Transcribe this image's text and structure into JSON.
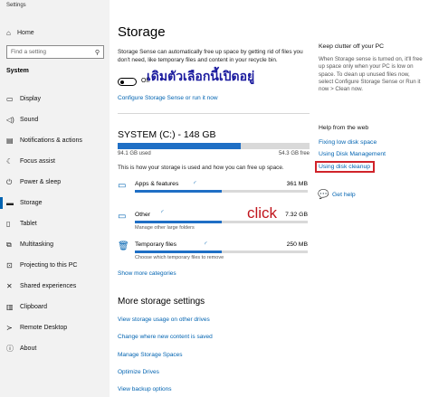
{
  "window": {
    "title": "Settings"
  },
  "sidebar": {
    "home_label": "Home",
    "search_placeholder": "Find a setting",
    "section_label": "System",
    "items": [
      {
        "label": "Display",
        "icon": "display-icon"
      },
      {
        "label": "Sound",
        "icon": "sound-icon"
      },
      {
        "label": "Notifications & actions",
        "icon": "notifications-icon"
      },
      {
        "label": "Focus assist",
        "icon": "focus-assist-icon"
      },
      {
        "label": "Power & sleep",
        "icon": "power-icon"
      },
      {
        "label": "Storage",
        "icon": "storage-icon",
        "active": true
      },
      {
        "label": "Tablet",
        "icon": "tablet-icon"
      },
      {
        "label": "Multitasking",
        "icon": "multitasking-icon"
      },
      {
        "label": "Projecting to this PC",
        "icon": "projecting-icon"
      },
      {
        "label": "Shared experiences",
        "icon": "shared-experiences-icon"
      },
      {
        "label": "Clipboard",
        "icon": "clipboard-icon"
      },
      {
        "label": "Remote Desktop",
        "icon": "remote-desktop-icon"
      },
      {
        "label": "About",
        "icon": "info-icon"
      }
    ]
  },
  "main": {
    "title": "Storage",
    "description": "Storage Sense can automatically free up space by getting rid of files you don't need, like temporary files and content in your recycle bin.",
    "storage_sense": {
      "state_label": "Off",
      "on": false
    },
    "thai_annotation": "เดิมตัวเลือกนี้เปิดอยู่",
    "configure_link": "Configure Storage Sense or run it now",
    "drive": {
      "title": "SYSTEM (C:) - 148 GB",
      "used": "94.1 GB used",
      "free": "54.3 GB free",
      "used_fraction": 0.64,
      "description": "This is how your storage is used and how you can free up space."
    },
    "categories": [
      {
        "name": "Apps & features",
        "size": "361 MB",
        "detail": "",
        "icon": "apps-features-icon",
        "fill": 0.5
      },
      {
        "name": "Other",
        "size": "7.32 GB",
        "detail": "Manage other large folders",
        "icon": "folder-icon",
        "fill": 0.5
      },
      {
        "name": "Temporary files",
        "size": "250 MB",
        "detail": "Choose which temporary files to remove",
        "icon": "trash-icon",
        "fill": 0.5
      }
    ],
    "click_annotation": "click",
    "show_more": "Show more categories",
    "more_settings": {
      "title": "More storage settings",
      "links": [
        "View storage usage on other drives",
        "Change where new content is saved",
        "Manage Storage Spaces",
        "Optimize Drives",
        "View backup options"
      ]
    }
  },
  "right_panel": {
    "heading": "Keep clutter off your PC",
    "text": "When Storage sense is turned on, it'll free up space only when your PC is low on space. To clean up unused files now, select Configure Storage Sense or Run it now > Clean now.",
    "help_heading": "Help from the web",
    "help_links": [
      "Fixing low disk space",
      "Using Disk Management",
      "Using disk cleanup"
    ],
    "get_help": "Get help"
  },
  "colors": {
    "accent": "#0063b1",
    "highlight_box": "#d0232a",
    "click_note": "#c0141c",
    "thai_note": "#1a1a9e"
  }
}
